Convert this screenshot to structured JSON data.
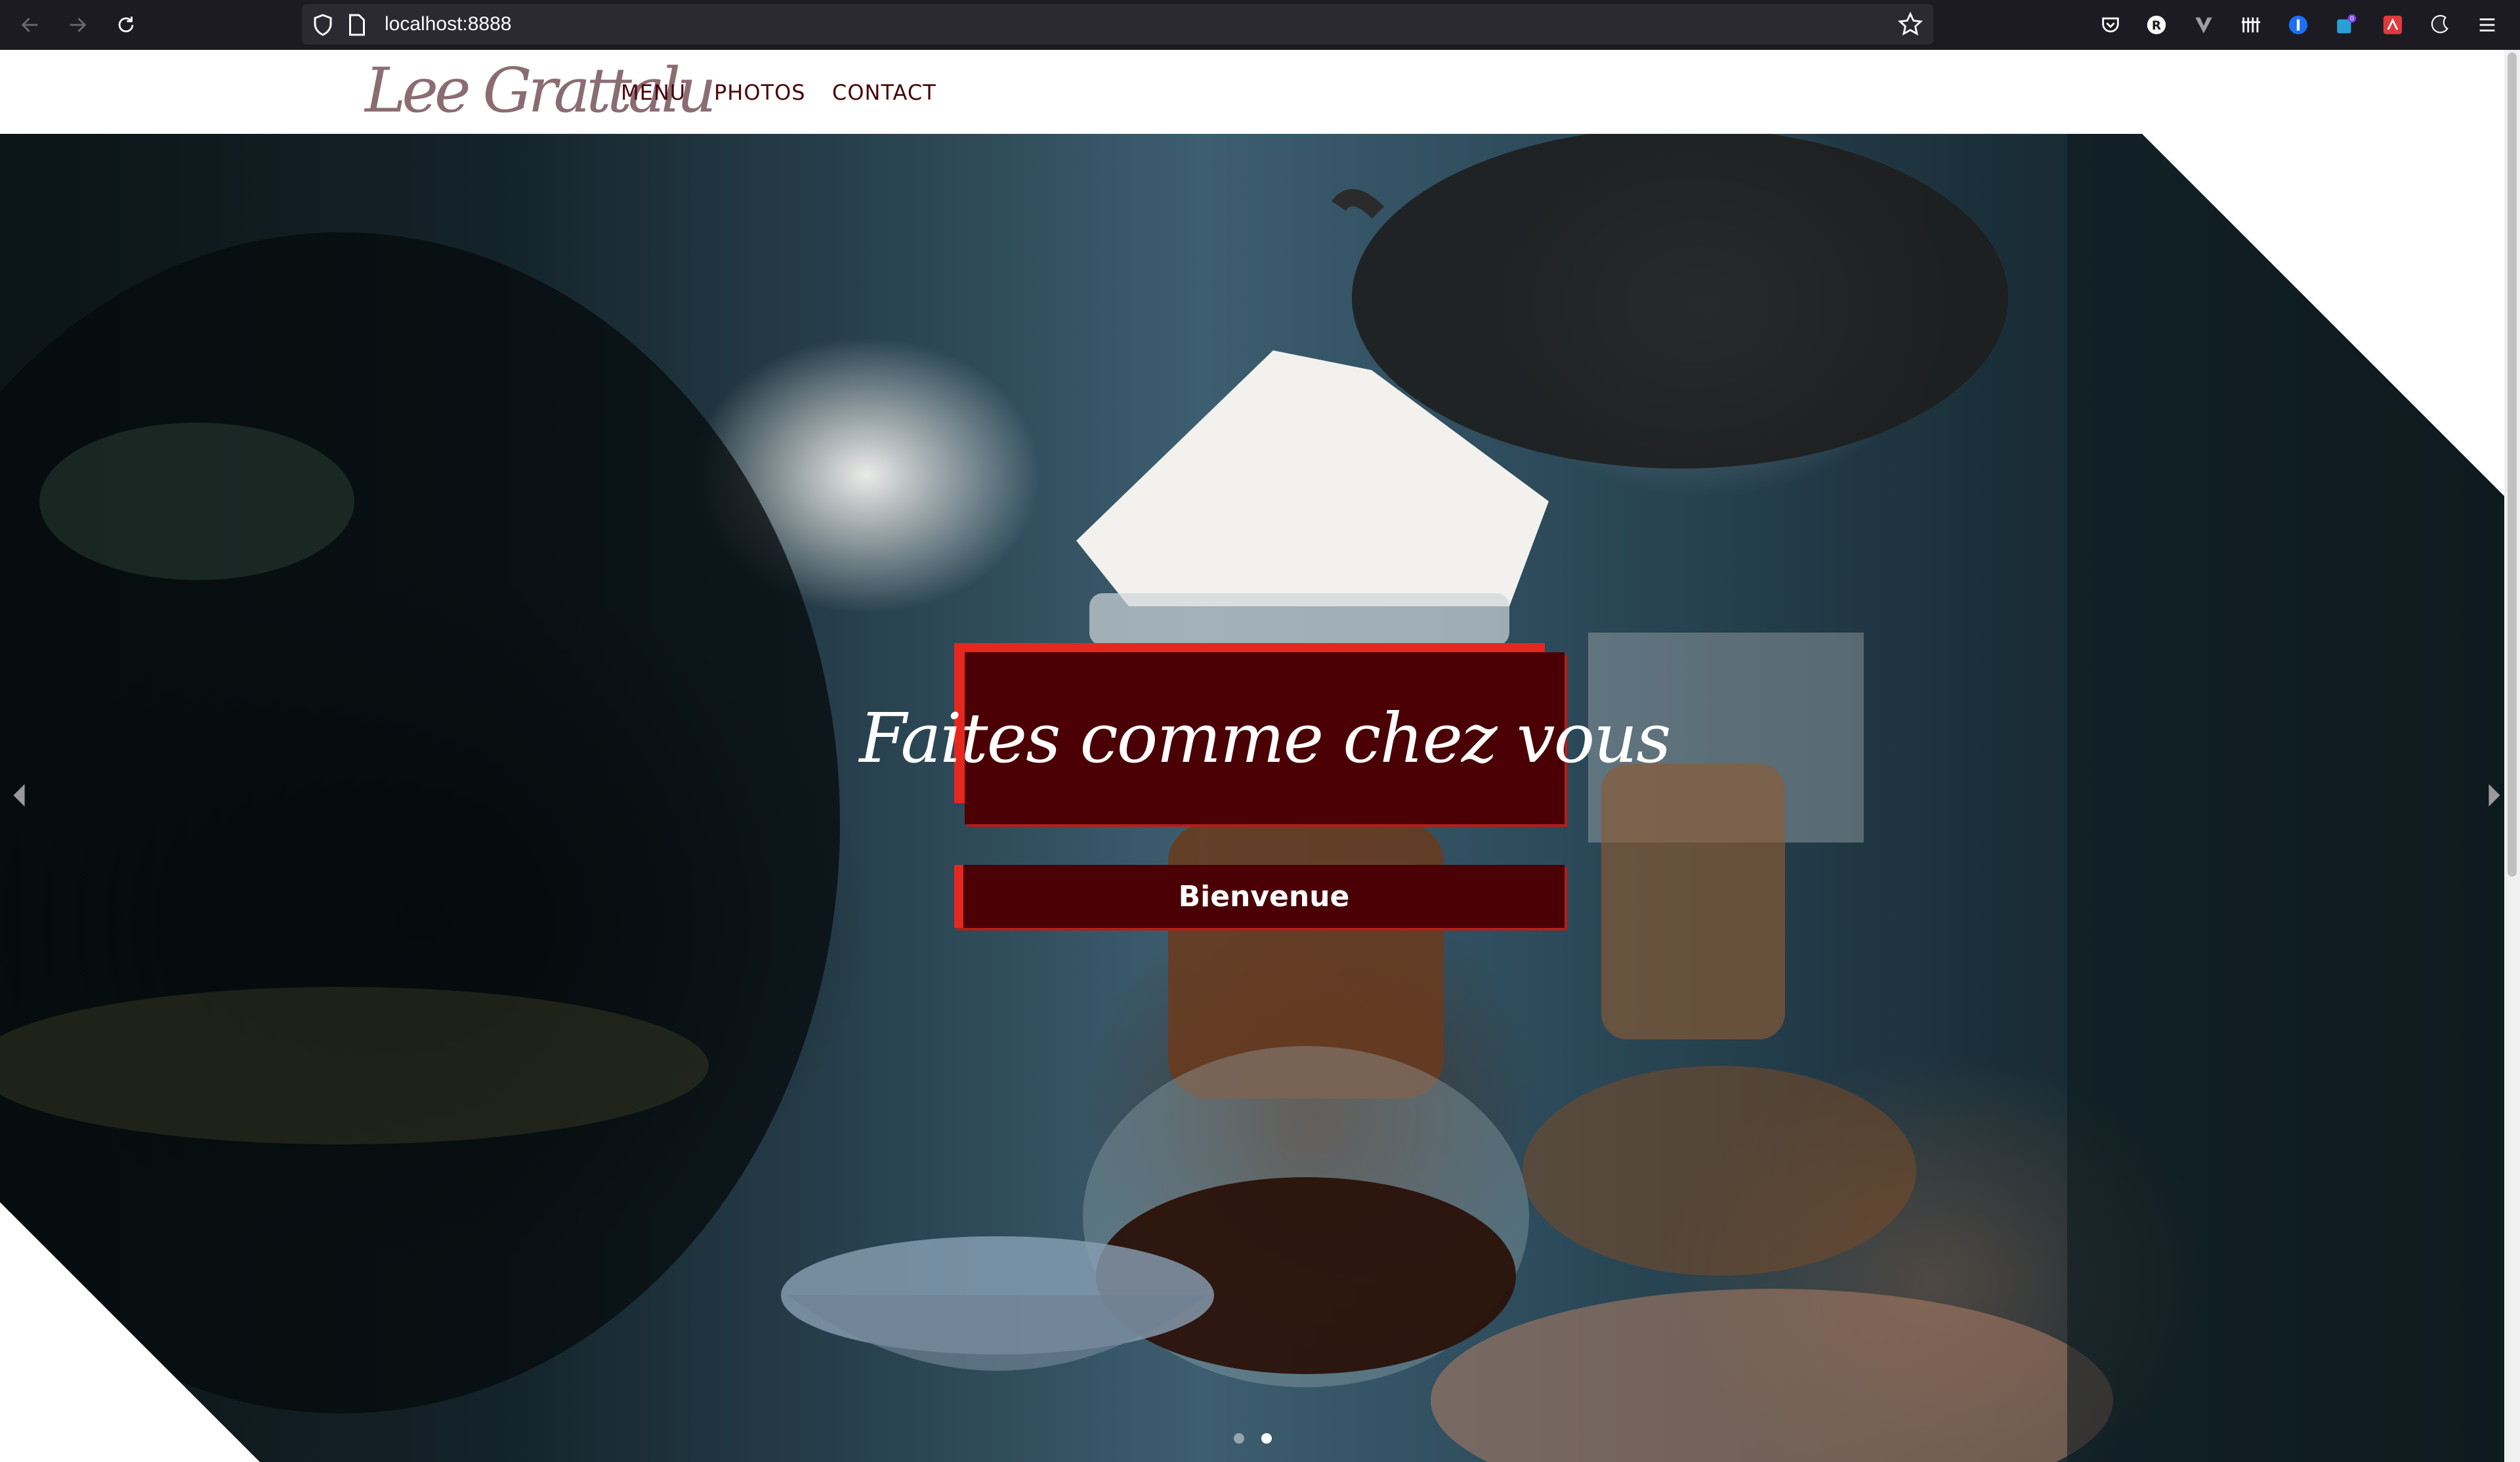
{
  "browser": {
    "url": "localhost:8888",
    "extensions": [
      "pocket-icon",
      "r-extension-icon",
      "vimium-icon",
      "ublock-icon",
      "info-extension-icon",
      "badge-extension-icon",
      "red-extension-icon",
      "dark-extension-icon",
      "hamburger-menu-icon"
    ],
    "extension_badge": "0"
  },
  "site": {
    "logo": "Lee Grattalu",
    "nav": {
      "menu": "MENU",
      "photos": "PHOTOS",
      "contact": "CONTACT"
    }
  },
  "hero": {
    "headline": "Faites comme chez vous",
    "welcome": "Bienvenue",
    "slides": {
      "count": 2,
      "active": 2
    }
  },
  "colors": {
    "brand_dark_red": "#4a0004",
    "brand_red": "#e5281f",
    "nav_text": "#4a0508"
  }
}
